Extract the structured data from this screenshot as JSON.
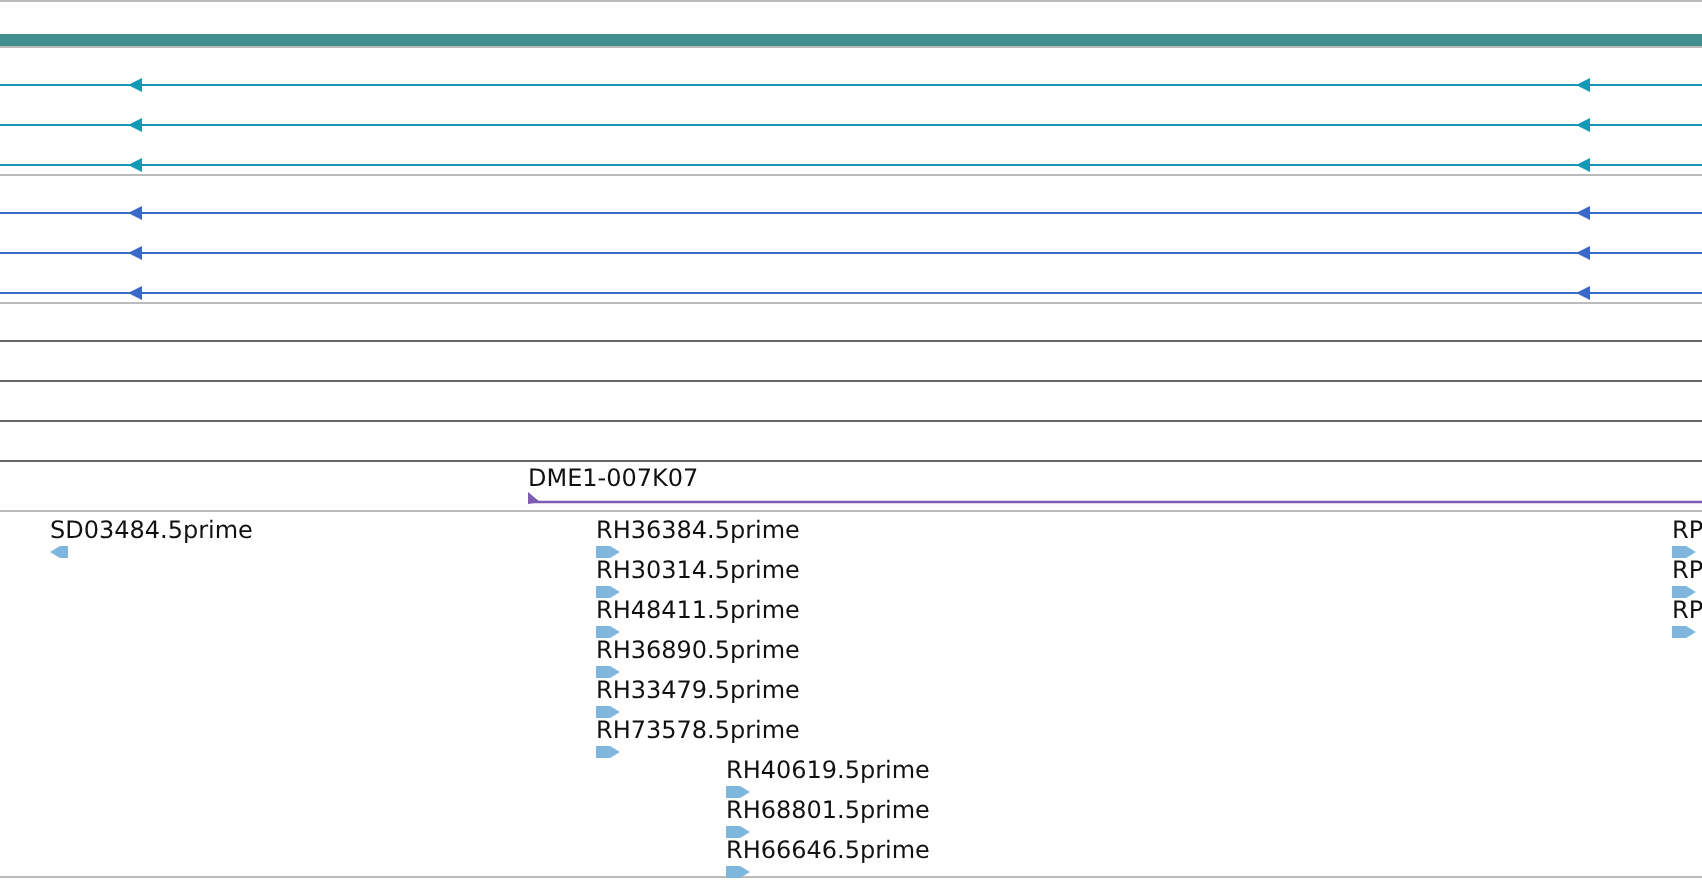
{
  "tracks": [
    {
      "kind": "bar",
      "color": "#3f8f8f"
    },
    {
      "kind": "transcripts",
      "color": "#1797b5",
      "rows": [
        {
          "kind": "reverse"
        },
        {
          "kind": "reverse"
        },
        {
          "kind": "reverse"
        }
      ]
    },
    {
      "kind": "transcripts",
      "color": "#3a68c8",
      "rows": [
        {
          "kind": "reverse"
        },
        {
          "kind": "reverse"
        },
        {
          "kind": "reverse"
        }
      ]
    },
    {
      "kind": "empty"
    },
    {
      "kind": "clone",
      "color": "#7b5cb0",
      "label": "DME1-007K07"
    },
    {
      "kind": "features",
      "color": "#7fb6dd",
      "items": [
        {
          "label": "SD03484.5prime",
          "kind": "reverse"
        },
        {
          "label": "RH36384.5prime",
          "kind": "forward"
        },
        {
          "label": "RH30314.5prime",
          "kind": "forward"
        },
        {
          "label": "RH48411.5prime",
          "kind": "forward"
        },
        {
          "label": "RH36890.5prime",
          "kind": "forward"
        },
        {
          "label": "RH33479.5prime",
          "kind": "forward"
        },
        {
          "label": "RH73578.5prime",
          "kind": "forward"
        },
        {
          "label": "RH40619.5prime",
          "kind": "forward"
        },
        {
          "label": "RH68801.5prime",
          "kind": "forward"
        },
        {
          "label": "RH66646.5prime",
          "kind": "forward"
        },
        {
          "label": "RP",
          "kind": "forward"
        },
        {
          "label": "RP",
          "kind": "forward"
        },
        {
          "label": "RP",
          "kind": "forward"
        }
      ]
    }
  ]
}
